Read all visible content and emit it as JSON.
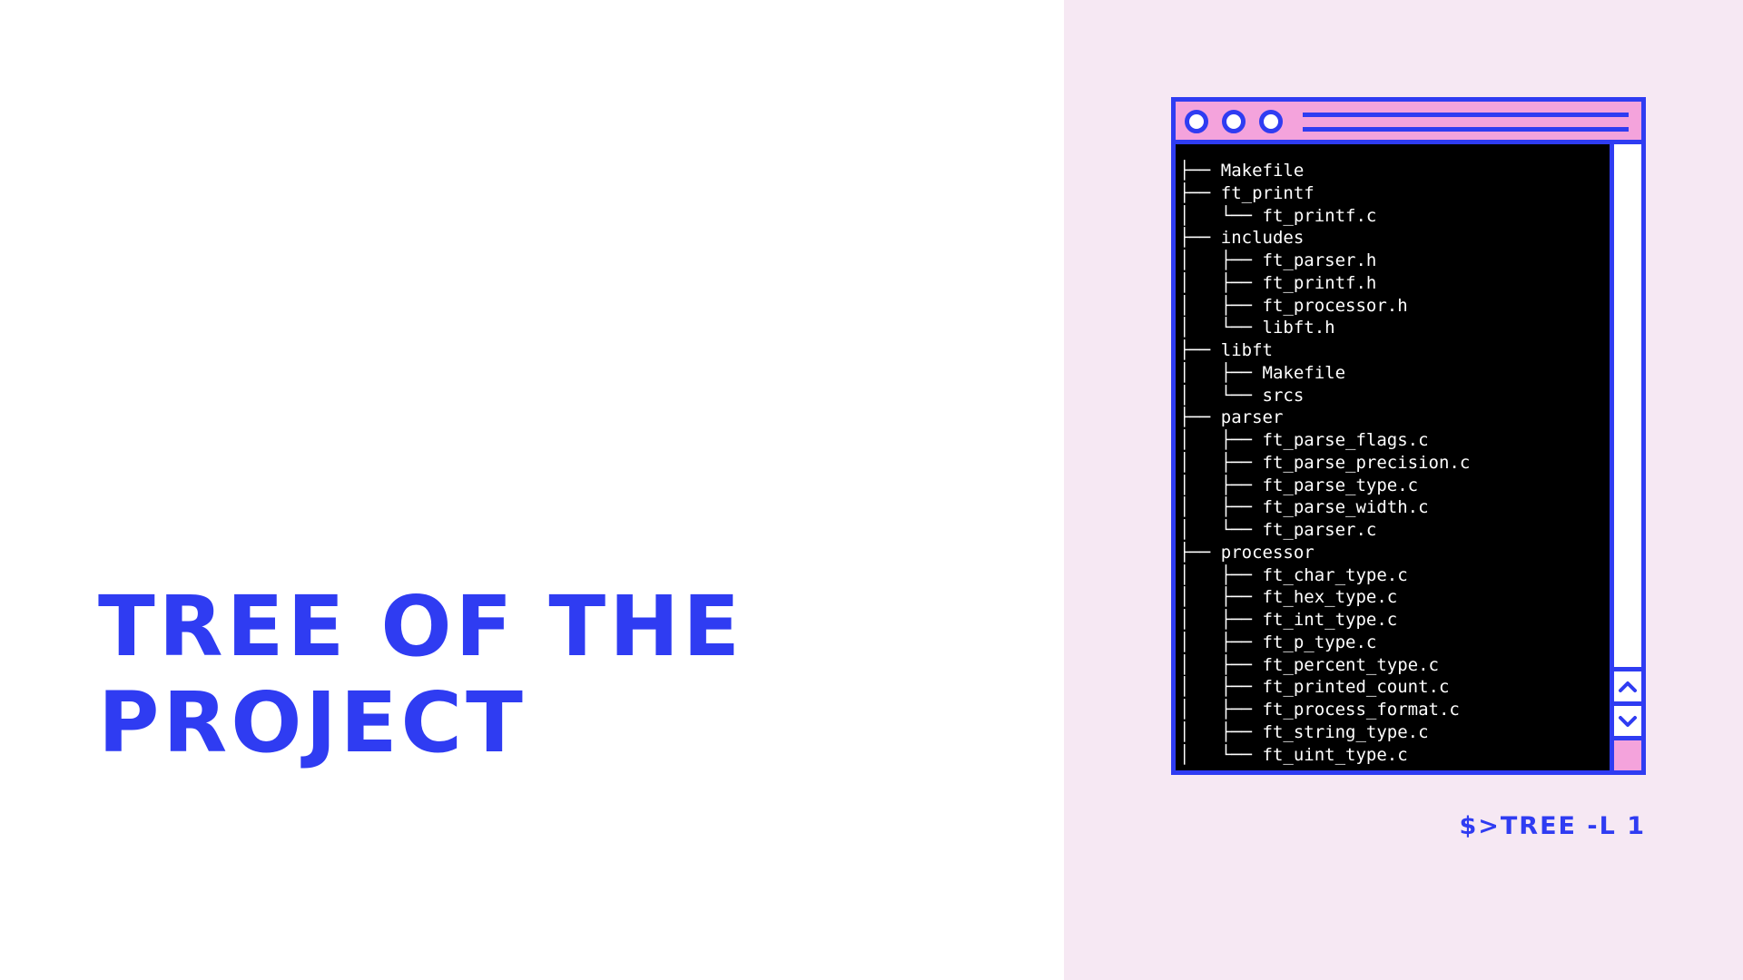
{
  "slide": {
    "title_line_1": "TREE OF THE",
    "title_line_2": "PROJECT"
  },
  "terminal": {
    "tree_lines": [
      "├── Makefile",
      "├── ft_printf",
      "│   └── ft_printf.c",
      "├── includes",
      "│   ├── ft_parser.h",
      "│   ├── ft_printf.h",
      "│   ├── ft_processor.h",
      "│   └── libft.h",
      "├── libft",
      "│   ├── Makefile",
      "│   └── srcs",
      "├── parser",
      "│   ├── ft_parse_flags.c",
      "│   ├── ft_parse_precision.c",
      "│   ├── ft_parse_type.c",
      "│   ├── ft_parse_width.c",
      "│   └── ft_parser.c",
      "├── processor",
      "│   ├── ft_char_type.c",
      "│   ├── ft_hex_type.c",
      "│   ├── ft_int_type.c",
      "│   ├── ft_p_type.c",
      "│   ├── ft_percent_type.c",
      "│   ├── ft_printed_count.c",
      "│   ├── ft_process_format.c",
      "│   ├── ft_string_type.c",
      "│   └── ft_uint_type.c"
    ],
    "command": "$>TREE -L 1"
  },
  "icons": {
    "scroll_up": "chevron-up-icon",
    "scroll_down": "chevron-down-icon"
  },
  "colors": {
    "accent": "#2f3cf2",
    "pink": "#f4a3dc",
    "panel_background": "#f6e8f3",
    "terminal_background": "#000000"
  }
}
